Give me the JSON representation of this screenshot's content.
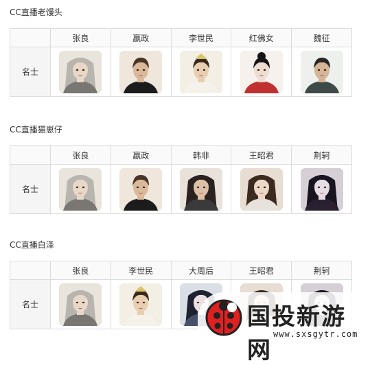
{
  "sections": [
    {
      "title": "CC直播老馒头",
      "row_label": "名士",
      "characters": [
        {
          "name": "张良",
          "portrait": "zhangliang"
        },
        {
          "name": "嬴政",
          "portrait": "yingzheng"
        },
        {
          "name": "李世民",
          "portrait": "lishimin"
        },
        {
          "name": "红佛女",
          "portrait": "hongfunv"
        },
        {
          "name": "魏征",
          "portrait": "weizheng"
        }
      ]
    },
    {
      "title": "CC直播猫崽仔",
      "row_label": "名士",
      "characters": [
        {
          "name": "张良",
          "portrait": "zhangliang"
        },
        {
          "name": "嬴政",
          "portrait": "yingzheng"
        },
        {
          "name": "韩非",
          "portrait": "hanfei"
        },
        {
          "name": "王昭君",
          "portrait": "wangzhaojun"
        },
        {
          "name": "荆轲",
          "portrait": "jingke"
        }
      ]
    },
    {
      "title": "CC直播白泽",
      "row_label": "名士",
      "characters": [
        {
          "name": "张良",
          "portrait": "zhangliang"
        },
        {
          "name": "李世民",
          "portrait": "lishimin"
        },
        {
          "name": "大周后",
          "portrait": "dazhouhou"
        },
        {
          "name": "王昭君",
          "portrait": "wangzhaojun"
        },
        {
          "name": "荆轲",
          "portrait": "jingke"
        }
      ]
    }
  ],
  "watermark": {
    "text": "国投新游网",
    "url": "www.sxsgytr.com",
    "logo_icon": "ladybug-logo-icon"
  },
  "colors": {
    "border": "#dcdcdc",
    "label_bg": "#f5f5f5",
    "logo_red": "#e02020"
  }
}
